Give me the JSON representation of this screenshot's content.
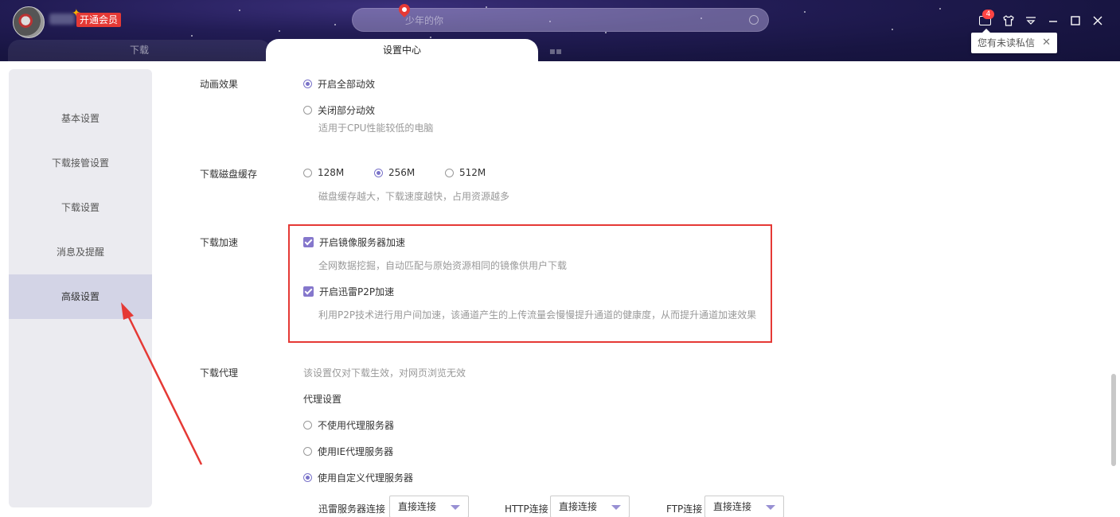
{
  "header": {
    "vip_label": "开通会员",
    "search_placeholder": "少年的你",
    "badge_count": "4",
    "tooltip_text": "您有未读私信",
    "tabs": [
      {
        "label": "下载"
      },
      {
        "label": "设置中心"
      }
    ]
  },
  "sidebar": {
    "items": [
      {
        "label": "基本设置"
      },
      {
        "label": "下载接管设置"
      },
      {
        "label": "下载设置"
      },
      {
        "label": "消息及提醒"
      },
      {
        "label": "高级设置",
        "active": true
      }
    ]
  },
  "settings": {
    "animation": {
      "label": "动画效果",
      "option_all": "开启全部动效",
      "option_partial": "关闭部分动效",
      "option_partial_desc": "适用于CPU性能较低的电脑"
    },
    "disk_cache": {
      "label": "下载磁盘缓存",
      "options": [
        "128M",
        "256M",
        "512M"
      ],
      "selected": "256M",
      "desc": "磁盘缓存越大，下载速度越快，占用资源越多"
    },
    "acceleration": {
      "label": "下载加速",
      "mirror_label": "开启镜像服务器加速",
      "mirror_desc": "全网数据挖掘，自动匹配与原始资源相同的镜像供用户下载",
      "p2p_label": "开启迅雷P2P加速",
      "p2p_desc": "利用P2P技术进行用户间加速，该通道产生的上传流量会慢慢提升通道的健康度，从而提升通道加速效果"
    },
    "proxy": {
      "label": "下载代理",
      "desc": "该设置仅对下载生效，对网页浏览无效",
      "settings_title": "代理设置",
      "option_none": "不使用代理服务器",
      "option_ie": "使用IE代理服务器",
      "option_custom": "使用自定义代理服务器",
      "xunlei_label": "迅雷服务器连接",
      "http_label": "HTTP连接",
      "ftp_label": "FTP连接",
      "xunlei_value": "直接连接",
      "http_value": "直接连接",
      "ftp_value": "直接连接"
    }
  },
  "colors": {
    "accent": "#7a73c9",
    "highlight_border": "#e53935",
    "vip": "#e53935"
  }
}
